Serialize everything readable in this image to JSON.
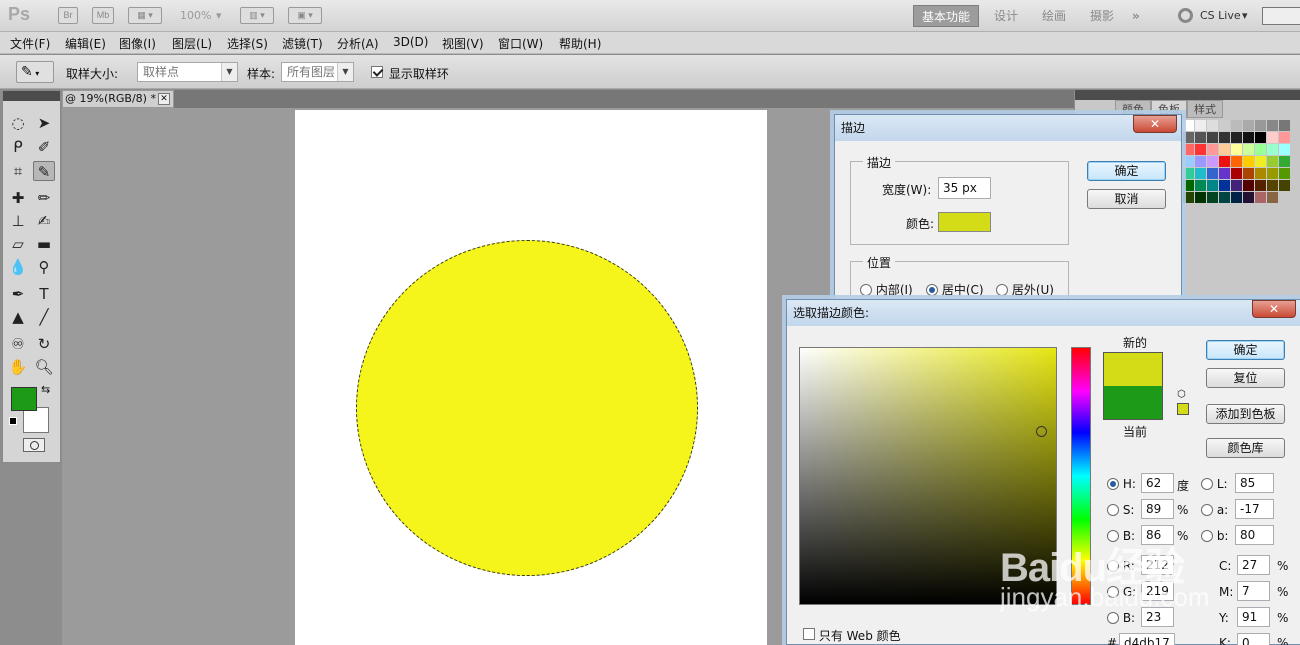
{
  "appbar": {
    "logo": "Ps",
    "br_label": "Br",
    "mb_label": "Mb",
    "zoom": "100%",
    "workspaces": [
      "基本功能",
      "设计",
      "绘画",
      "摄影"
    ],
    "more": "»",
    "cs_live": "CS Live"
  },
  "menu": [
    "文件(F)",
    "编辑(E)",
    "图像(I)",
    "图层(L)",
    "选择(S)",
    "滤镜(T)",
    "分析(A)",
    "3D(D)",
    "视图(V)",
    "窗口(W)",
    "帮助(H)"
  ],
  "options": {
    "sample_size_label": "取样大小:",
    "sample_size_value": "取样点",
    "sample_label": "样本:",
    "sample_value": "所有图层",
    "show_ring_label": "显示取样环"
  },
  "document": {
    "tab_title": "@ 19%(RGB/8) *",
    "close": "✕"
  },
  "right_panel": {
    "tabs": [
      "颜色",
      "色板",
      "样式"
    ]
  },
  "stroke_dialog": {
    "title": "描边",
    "group_stroke": "描边",
    "width_label": "宽度(W):",
    "width_value": "35 px",
    "color_label": "颜色:",
    "color_value": "#d4db17",
    "group_position": "位置",
    "pos_inside": "内部(I)",
    "pos_center": "居中(C)",
    "pos_outside": "居外(U)",
    "ok": "确定",
    "cancel": "取消"
  },
  "color_picker": {
    "title": "选取描边颜色:",
    "new_label": "新的",
    "current_label": "当前",
    "ok": "确定",
    "reset": "复位",
    "add_swatch": "添加到色板",
    "color_lib": "颜色库",
    "web_only": "只有 Web 颜色",
    "H": "62",
    "H_unit": "度",
    "S": "89",
    "S_unit": "%",
    "B": "86",
    "B_unit": "%",
    "R": "212",
    "G": "219",
    "Bv": "23",
    "hex": "d4db17",
    "L": "85",
    "a": "-17",
    "b": "80",
    "C": "27",
    "M": "7",
    "Y": "91",
    "K": "0",
    "pct": "%",
    "hash": "#"
  },
  "watermark": {
    "line1": "Baidu经验",
    "line2": "jingyan.baidu.com"
  }
}
